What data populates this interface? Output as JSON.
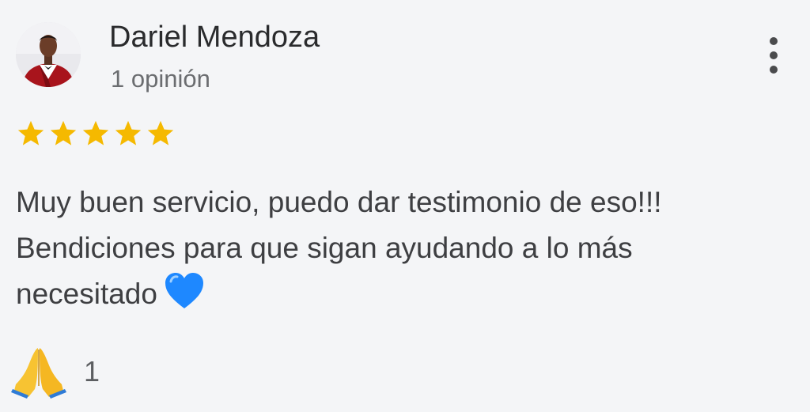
{
  "review": {
    "author_name": "Dariel Mendoza",
    "review_count": "1 opinión",
    "rating": 5,
    "rating_max": 5,
    "text_lines": [
      "Muy buen servicio, puedo dar testimonio de eso!!!",
      "Bendiciones para que sigan ayudando a lo más",
      "necesitado"
    ],
    "text_emoji": "blue-heart-icon",
    "reaction": {
      "icon": "folded-hands-icon",
      "count": "1"
    }
  },
  "colors": {
    "background": "#f4f5f7",
    "star": "#f5b900",
    "heart": "#1e88ff"
  },
  "menu": {
    "icon": "more-vertical-icon"
  }
}
